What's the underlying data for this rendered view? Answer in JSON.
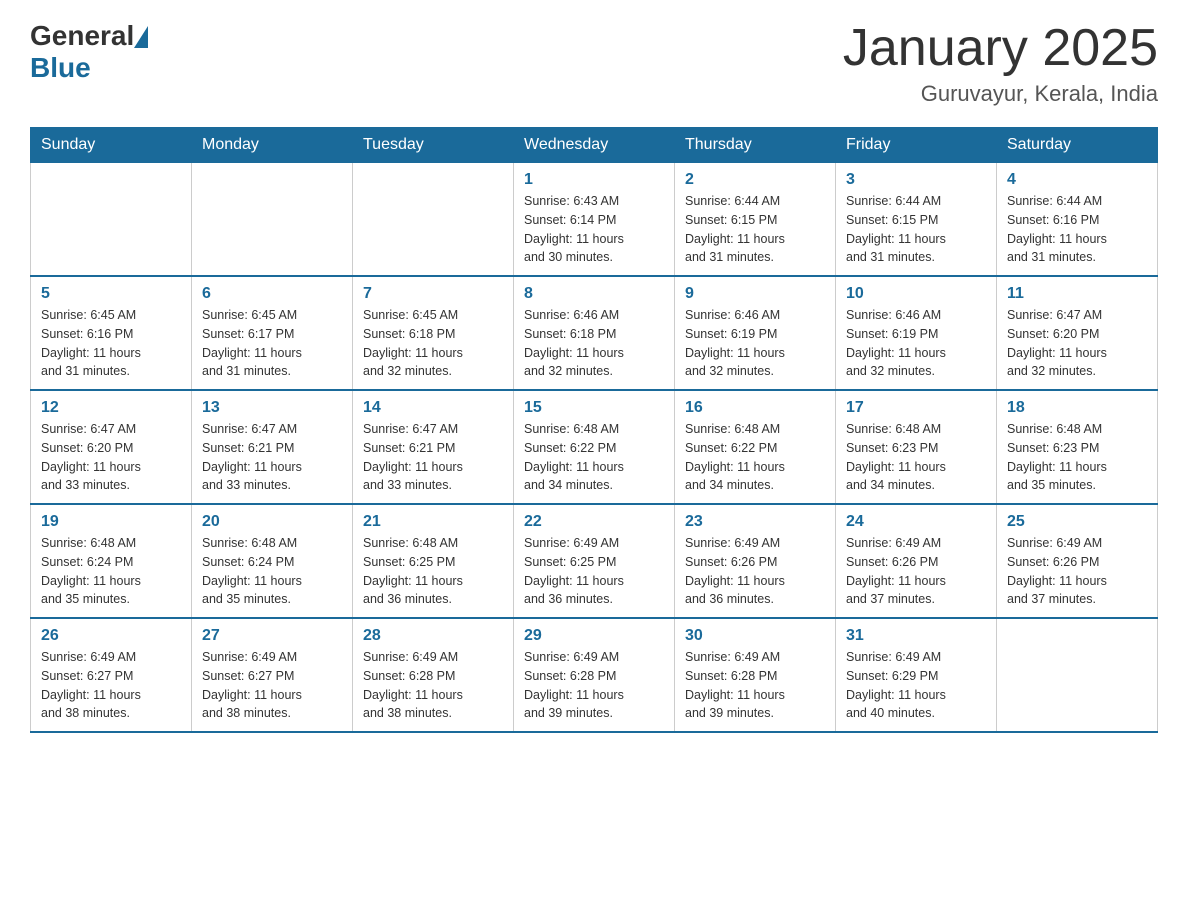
{
  "header": {
    "logo_general": "General",
    "logo_blue": "Blue",
    "title": "January 2025",
    "subtitle": "Guruvayur, Kerala, India"
  },
  "days_of_week": [
    "Sunday",
    "Monday",
    "Tuesday",
    "Wednesday",
    "Thursday",
    "Friday",
    "Saturday"
  ],
  "weeks": [
    [
      {
        "day": "",
        "info": ""
      },
      {
        "day": "",
        "info": ""
      },
      {
        "day": "",
        "info": ""
      },
      {
        "day": "1",
        "info": "Sunrise: 6:43 AM\nSunset: 6:14 PM\nDaylight: 11 hours\nand 30 minutes."
      },
      {
        "day": "2",
        "info": "Sunrise: 6:44 AM\nSunset: 6:15 PM\nDaylight: 11 hours\nand 31 minutes."
      },
      {
        "day": "3",
        "info": "Sunrise: 6:44 AM\nSunset: 6:15 PM\nDaylight: 11 hours\nand 31 minutes."
      },
      {
        "day": "4",
        "info": "Sunrise: 6:44 AM\nSunset: 6:16 PM\nDaylight: 11 hours\nand 31 minutes."
      }
    ],
    [
      {
        "day": "5",
        "info": "Sunrise: 6:45 AM\nSunset: 6:16 PM\nDaylight: 11 hours\nand 31 minutes."
      },
      {
        "day": "6",
        "info": "Sunrise: 6:45 AM\nSunset: 6:17 PM\nDaylight: 11 hours\nand 31 minutes."
      },
      {
        "day": "7",
        "info": "Sunrise: 6:45 AM\nSunset: 6:18 PM\nDaylight: 11 hours\nand 32 minutes."
      },
      {
        "day": "8",
        "info": "Sunrise: 6:46 AM\nSunset: 6:18 PM\nDaylight: 11 hours\nand 32 minutes."
      },
      {
        "day": "9",
        "info": "Sunrise: 6:46 AM\nSunset: 6:19 PM\nDaylight: 11 hours\nand 32 minutes."
      },
      {
        "day": "10",
        "info": "Sunrise: 6:46 AM\nSunset: 6:19 PM\nDaylight: 11 hours\nand 32 minutes."
      },
      {
        "day": "11",
        "info": "Sunrise: 6:47 AM\nSunset: 6:20 PM\nDaylight: 11 hours\nand 32 minutes."
      }
    ],
    [
      {
        "day": "12",
        "info": "Sunrise: 6:47 AM\nSunset: 6:20 PM\nDaylight: 11 hours\nand 33 minutes."
      },
      {
        "day": "13",
        "info": "Sunrise: 6:47 AM\nSunset: 6:21 PM\nDaylight: 11 hours\nand 33 minutes."
      },
      {
        "day": "14",
        "info": "Sunrise: 6:47 AM\nSunset: 6:21 PM\nDaylight: 11 hours\nand 33 minutes."
      },
      {
        "day": "15",
        "info": "Sunrise: 6:48 AM\nSunset: 6:22 PM\nDaylight: 11 hours\nand 34 minutes."
      },
      {
        "day": "16",
        "info": "Sunrise: 6:48 AM\nSunset: 6:22 PM\nDaylight: 11 hours\nand 34 minutes."
      },
      {
        "day": "17",
        "info": "Sunrise: 6:48 AM\nSunset: 6:23 PM\nDaylight: 11 hours\nand 34 minutes."
      },
      {
        "day": "18",
        "info": "Sunrise: 6:48 AM\nSunset: 6:23 PM\nDaylight: 11 hours\nand 35 minutes."
      }
    ],
    [
      {
        "day": "19",
        "info": "Sunrise: 6:48 AM\nSunset: 6:24 PM\nDaylight: 11 hours\nand 35 minutes."
      },
      {
        "day": "20",
        "info": "Sunrise: 6:48 AM\nSunset: 6:24 PM\nDaylight: 11 hours\nand 35 minutes."
      },
      {
        "day": "21",
        "info": "Sunrise: 6:48 AM\nSunset: 6:25 PM\nDaylight: 11 hours\nand 36 minutes."
      },
      {
        "day": "22",
        "info": "Sunrise: 6:49 AM\nSunset: 6:25 PM\nDaylight: 11 hours\nand 36 minutes."
      },
      {
        "day": "23",
        "info": "Sunrise: 6:49 AM\nSunset: 6:26 PM\nDaylight: 11 hours\nand 36 minutes."
      },
      {
        "day": "24",
        "info": "Sunrise: 6:49 AM\nSunset: 6:26 PM\nDaylight: 11 hours\nand 37 minutes."
      },
      {
        "day": "25",
        "info": "Sunrise: 6:49 AM\nSunset: 6:26 PM\nDaylight: 11 hours\nand 37 minutes."
      }
    ],
    [
      {
        "day": "26",
        "info": "Sunrise: 6:49 AM\nSunset: 6:27 PM\nDaylight: 11 hours\nand 38 minutes."
      },
      {
        "day": "27",
        "info": "Sunrise: 6:49 AM\nSunset: 6:27 PM\nDaylight: 11 hours\nand 38 minutes."
      },
      {
        "day": "28",
        "info": "Sunrise: 6:49 AM\nSunset: 6:28 PM\nDaylight: 11 hours\nand 38 minutes."
      },
      {
        "day": "29",
        "info": "Sunrise: 6:49 AM\nSunset: 6:28 PM\nDaylight: 11 hours\nand 39 minutes."
      },
      {
        "day": "30",
        "info": "Sunrise: 6:49 AM\nSunset: 6:28 PM\nDaylight: 11 hours\nand 39 minutes."
      },
      {
        "day": "31",
        "info": "Sunrise: 6:49 AM\nSunset: 6:29 PM\nDaylight: 11 hours\nand 40 minutes."
      },
      {
        "day": "",
        "info": ""
      }
    ]
  ]
}
